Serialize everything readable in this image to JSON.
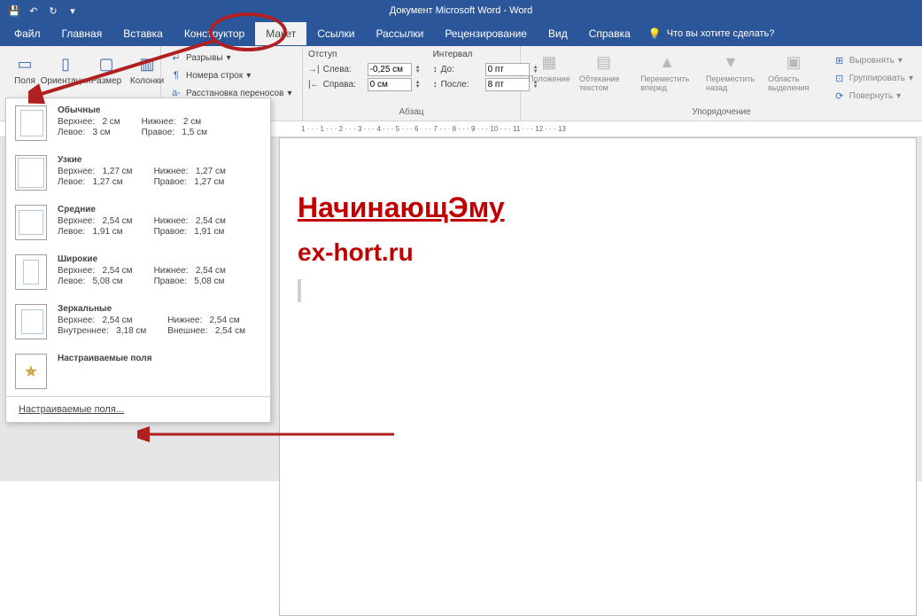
{
  "title": "Документ Microsoft Word  -  Word",
  "menu": {
    "file": "Файл",
    "home": "Главная",
    "insert": "Вставка",
    "design": "Конструктор",
    "layout": "Макет",
    "references": "Ссылки",
    "mailings": "Рассылки",
    "review": "Рецензирование",
    "view": "Вид",
    "help": "Справка",
    "tellme": "Что вы хотите сделать?"
  },
  "ribbon": {
    "pageSetup": {
      "margins": "Поля",
      "orientation": "Ориентация",
      "size": "Размер",
      "columns": "Колонки",
      "breaks": "Разрывы",
      "lineNumbers": "Номера строк",
      "hyphenation": "Расстановка переносов"
    },
    "paragraph": {
      "indentLabel": "Отступ",
      "spacingLabel": "Интервал",
      "left": "Слева:",
      "right": "Справа:",
      "before": "До:",
      "after": "После:",
      "leftVal": "-0,25 см",
      "rightVal": "0 см",
      "beforeVal": "0 пт",
      "afterVal": "8 пт",
      "groupLabel": "Абзац"
    },
    "arrange": {
      "position": "Положение",
      "wrap": "Обтекание текстом",
      "forward": "Переместить вперед",
      "backward": "Переместить назад",
      "selection": "Область выделения",
      "align": "Выровнять",
      "group": "Группировать",
      "rotate": "Повернуть",
      "groupLabel": "Упорядочение"
    }
  },
  "marginsMenu": {
    "presets": [
      {
        "name": "Обычные",
        "tl": "Верхнее:",
        "tv": "2 см",
        "bl": "Нижнее:",
        "bv": "2 см",
        "ll": "Левое:",
        "lv": "3 см",
        "rl": "Правое:",
        "rv": "1,5 см",
        "cls": "normal"
      },
      {
        "name": "Узкие",
        "tl": "Верхнее:",
        "tv": "1,27 см",
        "bl": "Нижнее:",
        "bv": "1,27 см",
        "ll": "Левое:",
        "lv": "1,27 см",
        "rl": "Правое:",
        "rv": "1,27 см",
        "cls": "narrow"
      },
      {
        "name": "Средние",
        "tl": "Верхнее:",
        "tv": "2,54 см",
        "bl": "Нижнее:",
        "bv": "2,54 см",
        "ll": "Левое:",
        "lv": "1,91 см",
        "rl": "Правое:",
        "rv": "1,91 см",
        "cls": "moderate"
      },
      {
        "name": "Широкие",
        "tl": "Верхнее:",
        "tv": "2,54 см",
        "bl": "Нижнее:",
        "bv": "2,54 см",
        "ll": "Левое:",
        "lv": "5,08 см",
        "rl": "Правое:",
        "rv": "5,08 см",
        "cls": "wide"
      },
      {
        "name": "Зеркальные",
        "tl": "Верхнее:",
        "tv": "2,54 см",
        "bl": "Нижнее:",
        "bv": "2,54 см",
        "ll": "Внутреннее:",
        "lv": "3,18 см",
        "rl": "Внешнее:",
        "rv": "2,54 см",
        "cls": "mirror"
      }
    ],
    "customPreset": "Настраиваемые поля",
    "customLink": "Настраиваемые поля..."
  },
  "document": {
    "heading": "НачинающЭму",
    "sub": "ex-hort.ru"
  },
  "ruler": [
    "1",
    "·",
    "·",
    "·",
    "1",
    "·",
    "·",
    "·",
    "2",
    "·",
    "·",
    "·",
    "3",
    "·",
    "·",
    "·",
    "4",
    "·",
    "·",
    "·",
    "5",
    "·",
    "·",
    "·",
    "6",
    "·",
    "·",
    "·",
    "7",
    "·",
    "·",
    "·",
    "8",
    "·",
    "·",
    "·",
    "9",
    "·",
    "·",
    "·",
    "10",
    "·",
    "·",
    "·",
    "11",
    "·",
    "·",
    "·",
    "12",
    "·",
    "·",
    "·",
    "13"
  ]
}
